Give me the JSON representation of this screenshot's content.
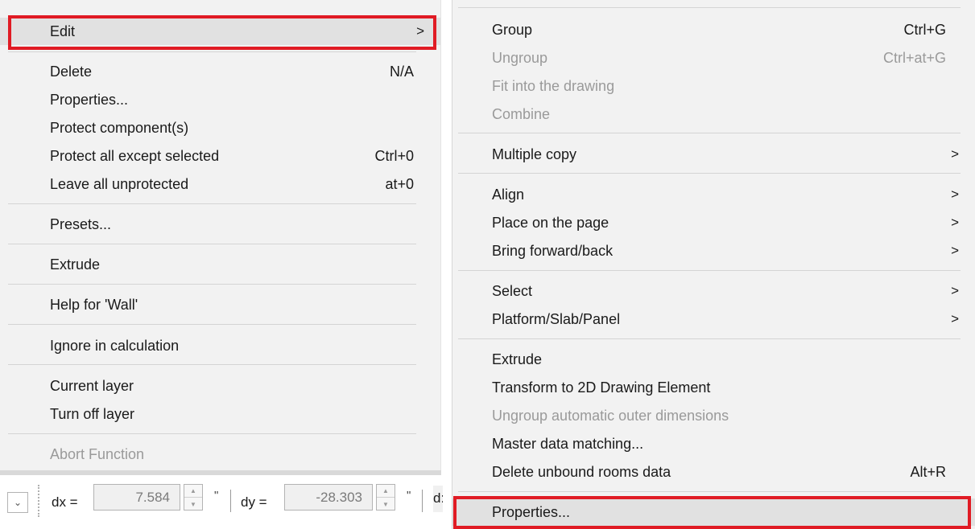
{
  "left_menu": {
    "edit_label": "Edit",
    "edit_arrow": ">",
    "delete_label": "Delete",
    "delete_shortcut": "N/A",
    "properties_label": "Properties...",
    "protect_component_label": "Protect component(s)",
    "protect_all_except_label": "Protect all except selected",
    "protect_all_except_shortcut": "Ctrl+0",
    "leave_unprotected_label": "Leave all unprotected",
    "leave_unprotected_shortcut": "at+0",
    "presets_label": "Presets...",
    "extrude_label": "Extrude",
    "help_label": "Help for 'Wall'",
    "ignore_label": "Ignore in calculation",
    "current_layer_label": "Current layer",
    "turn_off_layer_label": "Turn off layer",
    "abort_label": "Abort Function"
  },
  "right_menu": {
    "group_label": "Group",
    "group_shortcut": "Ctrl+G",
    "ungroup_label": "Ungroup",
    "ungroup_shortcut": "Ctrl+at+G",
    "fit_label": "Fit into the drawing",
    "combine_label": "Combine",
    "multiple_copy_label": "Multiple copy",
    "align_label": "Align",
    "place_label": "Place on the page",
    "bring_label": "Bring forward/back",
    "select_label": "Select",
    "platform_label": "Platform/Slab/Panel",
    "extrude_label": "Extrude",
    "transform_label": "Transform to 2D Drawing Element",
    "ungroup_auto_label": "Ungroup automatic outer dimensions",
    "master_data_label": "Master data matching...",
    "delete_unbound_label": "Delete unbound rooms data",
    "delete_unbound_shortcut": "Alt+R",
    "properties_label": "Properties...",
    "arrow": ">"
  },
  "toolbar": {
    "dropdown_icon": "⌄",
    "dx_label": "dx =",
    "dx_value": "7.584",
    "dy_label": "dy =",
    "dy_value": "-28.303",
    "unit": "\"",
    "spin_up": "▲",
    "spin_down": "▼",
    "truncated_label": "d:"
  },
  "colors": {
    "menu_bg": "#f2f2f2",
    "highlight_bg": "#e1e1e1",
    "disabled_text": "#9a9a9a",
    "callout_red": "#e01b24"
  }
}
